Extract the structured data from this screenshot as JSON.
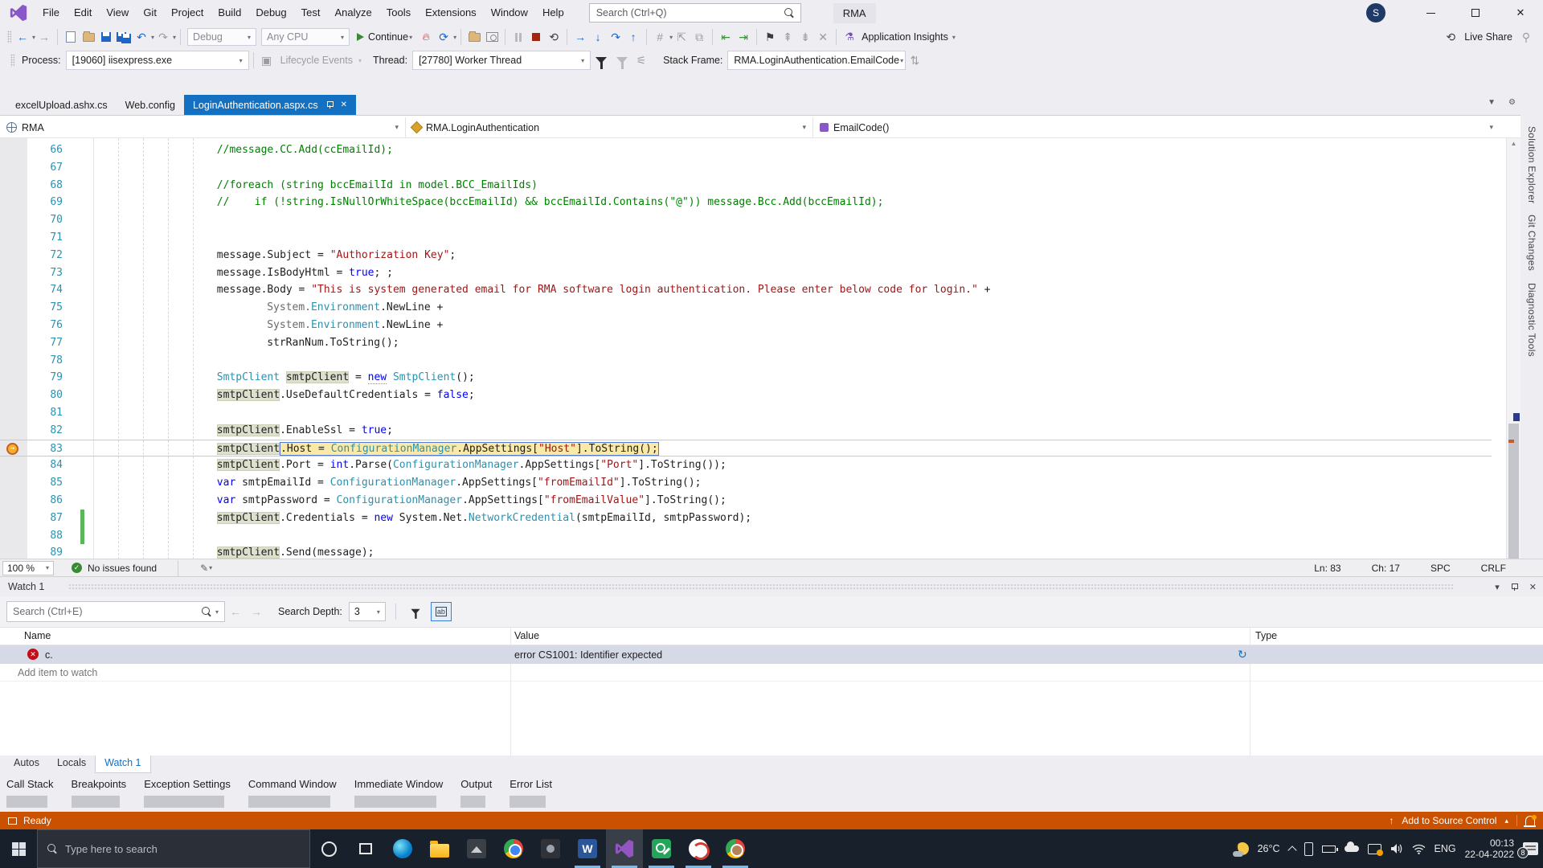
{
  "colors": {
    "accent_blue": "#1470C1",
    "statusbar_orange": "#CA5100",
    "current_line_yellow": "#FBE9A8",
    "reference_highlight": "#DCE0CC",
    "comment_green": "#008000",
    "string_red": "#A31515",
    "keyword_blue": "#0000FF",
    "type_teal": "#2B91AF",
    "taskbar_dark": "#18202B"
  },
  "titlebar": {
    "menus": [
      "File",
      "Edit",
      "View",
      "Git",
      "Project",
      "Build",
      "Debug",
      "Test",
      "Analyze",
      "Tools",
      "Extensions",
      "Window",
      "Help"
    ],
    "search_placeholder": "Search (Ctrl+Q)",
    "solution_name": "RMA",
    "avatar_initial": "S"
  },
  "toolbar": {
    "config": "Debug",
    "platform": "Any CPU",
    "continue_label": "Continue",
    "app_insights_label": "Application Insights",
    "live_share_label": "Live Share"
  },
  "debugbar": {
    "process_label": "Process:",
    "process_value": "[19060] iisexpress.exe",
    "lifecycle_label": "Lifecycle Events",
    "thread_label": "Thread:",
    "thread_value": "[27780] Worker Thread",
    "stackframe_label": "Stack Frame:",
    "stackframe_value": "RMA.LoginAuthentication.EmailCode"
  },
  "tabs": [
    {
      "label": "excelUpload.ashx.cs",
      "active": false
    },
    {
      "label": "Web.config",
      "active": false
    },
    {
      "label": "LoginAuthentication.aspx.cs",
      "active": true
    }
  ],
  "navbar": {
    "project": "RMA",
    "type": "RMA.LoginAuthentication",
    "member": "EmailCode()"
  },
  "editor": {
    "lines": [
      {
        "n": "66",
        "ind": 16,
        "tokens": [
          {
            "t": "//message.CC.Add(ccEmailId);",
            "c": "cm"
          }
        ]
      },
      {
        "n": "67",
        "ind": 0,
        "tokens": []
      },
      {
        "n": "68",
        "ind": 16,
        "tokens": [
          {
            "t": "//foreach (string bccEmailId in model.BCC_EmailIds)",
            "c": "cm"
          }
        ]
      },
      {
        "n": "69",
        "ind": 16,
        "tokens": [
          {
            "t": "//    if (!string.IsNullOrWhiteSpace(bccEmailId) && bccEmailId.Contains(\"@\")) message.Bcc.Add(bccEmailId);",
            "c": "cm"
          }
        ]
      },
      {
        "n": "70",
        "ind": 0,
        "tokens": []
      },
      {
        "n": "71",
        "ind": 0,
        "tokens": []
      },
      {
        "n": "72",
        "ind": 16,
        "tokens": [
          {
            "t": "message.Subject = ",
            "c": "pl"
          },
          {
            "t": "\"Authorization Key\"",
            "c": "st"
          },
          {
            "t": ";",
            "c": "pl"
          }
        ]
      },
      {
        "n": "73",
        "ind": 16,
        "tokens": [
          {
            "t": "message.IsBodyHtml = ",
            "c": "pl"
          },
          {
            "t": "true",
            "c": "kw"
          },
          {
            "t": "; ;",
            "c": "pl"
          }
        ]
      },
      {
        "n": "74",
        "ind": 16,
        "tokens": [
          {
            "t": "message.Body = ",
            "c": "pl"
          },
          {
            "t": "\"This is system generated email for RMA software login authentication. Please enter below code for login.\"",
            "c": "st"
          },
          {
            "t": " +",
            "c": "pl"
          }
        ]
      },
      {
        "n": "75",
        "ind": 24,
        "tokens": [
          {
            "t": "System.",
            "c": "ns"
          },
          {
            "t": "Environment",
            "c": "ty"
          },
          {
            "t": ".NewLine +",
            "c": "pl"
          }
        ]
      },
      {
        "n": "76",
        "ind": 24,
        "tokens": [
          {
            "t": "System.",
            "c": "ns"
          },
          {
            "t": "Environment",
            "c": "ty"
          },
          {
            "t": ".NewLine +",
            "c": "pl"
          }
        ]
      },
      {
        "n": "77",
        "ind": 24,
        "tokens": [
          {
            "t": "strRanNum.ToString();",
            "c": "pl"
          }
        ]
      },
      {
        "n": "78",
        "ind": 0,
        "tokens": []
      },
      {
        "n": "79",
        "ind": 16,
        "tokens": [
          {
            "t": "SmtpClient ",
            "c": "ty"
          },
          {
            "t": "smtpClient",
            "c": "pl hl"
          },
          {
            "t": " = ",
            "c": "pl"
          },
          {
            "t": "new",
            "c": "kw u"
          },
          {
            "t": " ",
            "c": "pl"
          },
          {
            "t": "SmtpClient",
            "c": "ty"
          },
          {
            "t": "();",
            "c": "pl"
          }
        ]
      },
      {
        "n": "80",
        "ind": 16,
        "tokens": [
          {
            "t": "smtpClient",
            "c": "pl hl"
          },
          {
            "t": ".UseDefaultCredentials = ",
            "c": "pl"
          },
          {
            "t": "false",
            "c": "kw"
          },
          {
            "t": ";",
            "c": "pl"
          }
        ]
      },
      {
        "n": "81",
        "ind": 0,
        "tokens": []
      },
      {
        "n": "82",
        "ind": 16,
        "tokens": [
          {
            "t": "smtpClient",
            "c": "pl hl"
          },
          {
            "t": ".EnableSsl = ",
            "c": "pl"
          },
          {
            "t": "true",
            "c": "kw"
          },
          {
            "t": ";",
            "c": "pl"
          }
        ]
      },
      {
        "n": "83",
        "ind": 16,
        "cur": true,
        "boxFrom": 1,
        "tokens": [
          {
            "t": "smtpClient",
            "c": "pl hl"
          },
          {
            "t": ".Host = ",
            "c": "pl"
          },
          {
            "t": "ConfigurationManager",
            "c": "ty"
          },
          {
            "t": ".AppSettings[",
            "c": "pl"
          },
          {
            "t": "\"Host\"",
            "c": "st"
          },
          {
            "t": "].ToString();",
            "c": "pl"
          }
        ]
      },
      {
        "n": "84",
        "ind": 16,
        "tokens": [
          {
            "t": "smtpClient",
            "c": "pl hl"
          },
          {
            "t": ".Port = ",
            "c": "pl"
          },
          {
            "t": "int",
            "c": "kw"
          },
          {
            "t": ".Parse(",
            "c": "pl"
          },
          {
            "t": "ConfigurationManager",
            "c": "ty"
          },
          {
            "t": ".AppSettings[",
            "c": "pl"
          },
          {
            "t": "\"Port\"",
            "c": "st"
          },
          {
            "t": "].ToString());",
            "c": "pl"
          }
        ]
      },
      {
        "n": "85",
        "ind": 16,
        "tokens": [
          {
            "t": "var",
            "c": "kw"
          },
          {
            "t": " smtpEmailId = ",
            "c": "pl"
          },
          {
            "t": "ConfigurationManager",
            "c": "ty"
          },
          {
            "t": ".AppSettings[",
            "c": "pl"
          },
          {
            "t": "\"fromEmailId\"",
            "c": "st"
          },
          {
            "t": "].ToString();",
            "c": "pl"
          }
        ]
      },
      {
        "n": "86",
        "ind": 16,
        "tokens": [
          {
            "t": "var",
            "c": "kw"
          },
          {
            "t": " smtpPassword = ",
            "c": "pl"
          },
          {
            "t": "ConfigurationManager",
            "c": "ty"
          },
          {
            "t": ".AppSettings[",
            "c": "pl"
          },
          {
            "t": "\"fromEmailValue\"",
            "c": "st"
          },
          {
            "t": "].ToString();",
            "c": "pl"
          }
        ]
      },
      {
        "n": "87",
        "ind": 16,
        "chg": true,
        "tokens": [
          {
            "t": "smtpClient",
            "c": "pl hl"
          },
          {
            "t": ".Credentials = ",
            "c": "pl"
          },
          {
            "t": "new",
            "c": "kw"
          },
          {
            "t": " System.Net.",
            "c": "pl"
          },
          {
            "t": "NetworkCredential",
            "c": "ty"
          },
          {
            "t": "(smtpEmailId, smtpPassword);",
            "c": "pl"
          }
        ]
      },
      {
        "n": "88",
        "ind": 0,
        "chg": true,
        "tokens": []
      },
      {
        "n": "89",
        "ind": 16,
        "tokens": [
          {
            "t": "smtpClient",
            "c": "pl hl"
          },
          {
            "t": ".Send(message);",
            "c": "pl"
          }
        ]
      }
    ]
  },
  "editor_status": {
    "zoom": "100 %",
    "issues": "No issues found",
    "ln": "Ln: 83",
    "ch": "Ch: 17",
    "spc": "SPC",
    "eol": "CRLF"
  },
  "watch": {
    "title": "Watch 1",
    "search_placeholder": "Search (Ctrl+E)",
    "depth_label": "Search Depth:",
    "depth_value": "3",
    "columns": [
      "Name",
      "Value",
      "Type"
    ],
    "rows": [
      {
        "name": "c.",
        "value": "error CS1001: Identifier expected",
        "type": ""
      }
    ],
    "add_label": "Add item to watch"
  },
  "panel_tabs": [
    {
      "label": "Autos",
      "active": false
    },
    {
      "label": "Locals",
      "active": false
    },
    {
      "label": "Watch 1",
      "active": true
    }
  ],
  "window_tabs": [
    "Call Stack",
    "Breakpoints",
    "Exception Settings",
    "Command Window",
    "Immediate Window",
    "Output",
    "Error List"
  ],
  "statusbar": {
    "ready": "Ready",
    "source_control": "Add to Source Control"
  },
  "right_sidebar": [
    "Solution Explorer",
    "Git Changes",
    "Diagnostic Tools"
  ],
  "taskbar": {
    "search_placeholder": "Type here to search",
    "temperature": "26°C",
    "language": "ENG",
    "time": "00:13",
    "date": "22-04-2022",
    "notification_count": "8"
  }
}
